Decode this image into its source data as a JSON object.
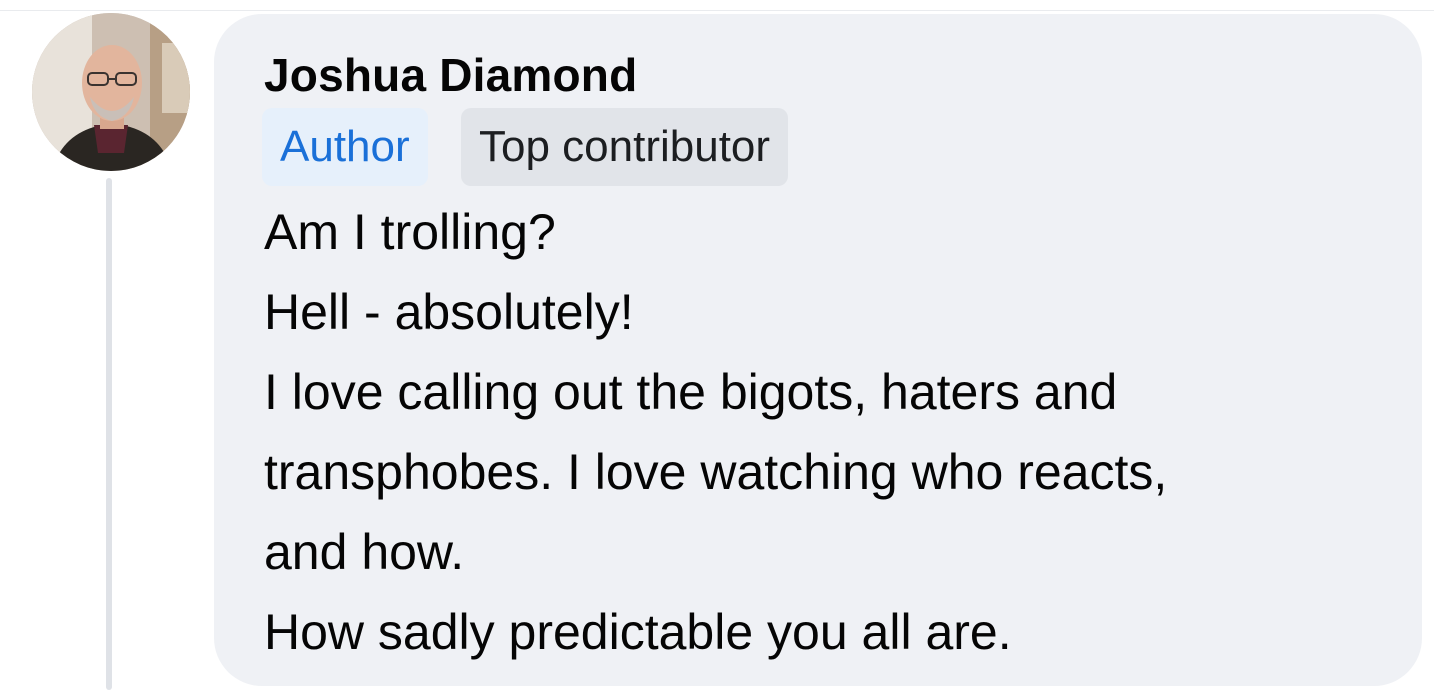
{
  "comment": {
    "author": "Joshua Diamond",
    "badges": [
      "Author",
      "Top contributor"
    ],
    "lines": [
      "Am I trolling?",
      "Hell - absolutely!",
      "I love calling out the bigots, haters and",
      "transphobes. I love watching who reacts,",
      "and how.",
      "How sadly predictable you all are."
    ]
  },
  "colors": {
    "bubble": "#eff1f5",
    "author_badge_text": "#1a70d8",
    "author_badge_bg": "#e6f0fb",
    "top_badge_bg": "#e1e4e9",
    "text": "#050505"
  }
}
